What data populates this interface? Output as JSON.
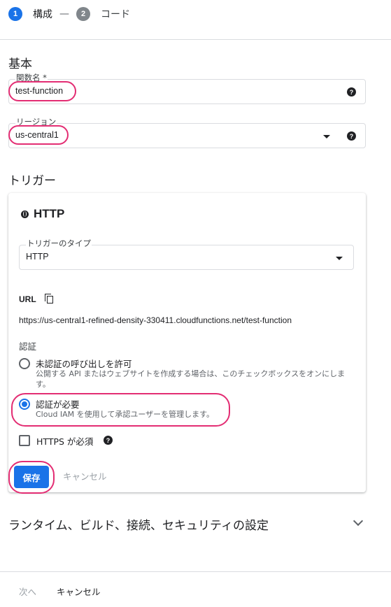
{
  "stepper": {
    "steps": [
      {
        "number": "1",
        "label": "構成"
      },
      {
        "number": "2",
        "label": "コード"
      }
    ],
    "separator": "—"
  },
  "basic": {
    "title": "基本",
    "function_name": {
      "label": "関数名 *",
      "value": "test-function",
      "help": "?"
    },
    "region": {
      "label": "リージョン",
      "value": "us-central1",
      "help": "?"
    }
  },
  "trigger": {
    "section_title": "トリガー",
    "card_title": "HTTP",
    "type_field": {
      "label": "トリガーのタイプ",
      "value": "HTTP"
    },
    "url_label": "URL",
    "url_value": "https://us-central1-refined-density-330411.cloudfunctions.net/test-function",
    "auth_label": "認証",
    "auth_options": [
      {
        "title": "未認証の呼び出しを許可",
        "desc": "公開する API またはウェブサイトを作成する場合は、このチェックボックスをオンにします。",
        "checked": false
      },
      {
        "title": "認証が必要",
        "desc": "Cloud IAM を使用して承認ユーザーを管理します。",
        "checked": true
      }
    ],
    "https_required": {
      "label": "HTTPS が必須",
      "checked": false,
      "help": "?"
    },
    "save_label": "保存",
    "cancel_label": "キャンセル"
  },
  "runtime_section": {
    "title": "ランタイム、ビルド、接続、セキュリティの設定"
  },
  "footer": {
    "next_label": "次へ",
    "cancel_label": "キャンセル"
  },
  "colors": {
    "accent": "#1a73e8",
    "highlight": "#e32d73",
    "border": "#dadce0"
  }
}
